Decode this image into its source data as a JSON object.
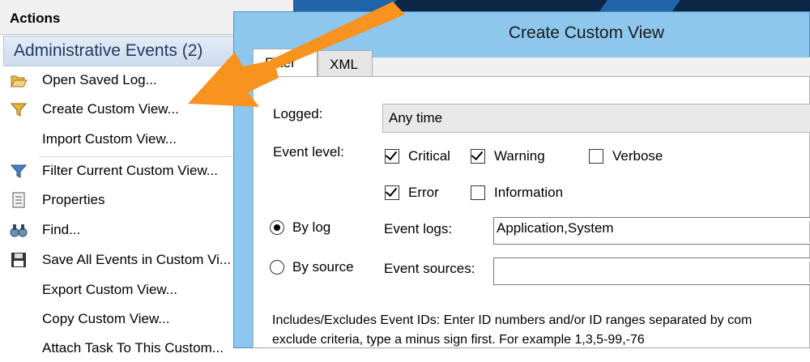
{
  "actions": {
    "title": "Actions",
    "section": "Administrative Events (2)",
    "items": [
      {
        "label": "Open Saved Log...",
        "icon": "folder-open-icon"
      },
      {
        "label": "Create Custom View...",
        "icon": "funnel-icon"
      },
      {
        "label": "Import Custom View...",
        "icon": ""
      },
      {
        "label": "Filter Current Custom View...",
        "icon": "funnel-icon"
      },
      {
        "label": "Properties",
        "icon": "properties-icon"
      },
      {
        "label": "Find...",
        "icon": "binoculars-icon"
      },
      {
        "label": "Save All Events in Custom Vi...",
        "icon": "floppy-disk-icon"
      },
      {
        "label": "Export Custom View...",
        "icon": ""
      },
      {
        "label": "Copy Custom View...",
        "icon": ""
      },
      {
        "label": "Attach Task To This Custom...",
        "icon": ""
      }
    ]
  },
  "dialog": {
    "title": "Create Custom View",
    "tabs": {
      "filter": "Filter",
      "xml": "XML"
    },
    "logged_label": "Logged:",
    "logged_value": "Any time",
    "event_level_label": "Event level:",
    "levels": {
      "critical": {
        "label": "Critical",
        "checked": true
      },
      "warning": {
        "label": "Warning",
        "checked": true
      },
      "verbose": {
        "label": "Verbose",
        "checked": false
      },
      "error": {
        "label": "Error",
        "checked": true
      },
      "information": {
        "label": "Information",
        "checked": false
      }
    },
    "by_log_label": "By log",
    "by_source_label": "By source",
    "selected_mode": "By log",
    "event_logs_label": "Event logs:",
    "event_logs_value": "Application,System",
    "event_sources_label": "Event sources:",
    "event_sources_value": "",
    "description_line1": "Includes/Excludes Event IDs: Enter ID numbers and/or ID ranges separated by com",
    "description_line2": "exclude criteria, type a minus sign first. For example 1,3,5-99,-76"
  },
  "colors": {
    "arrow": "#f7931e",
    "dialog_frame": "#8ec7ee",
    "section_header": "#cddbee"
  }
}
